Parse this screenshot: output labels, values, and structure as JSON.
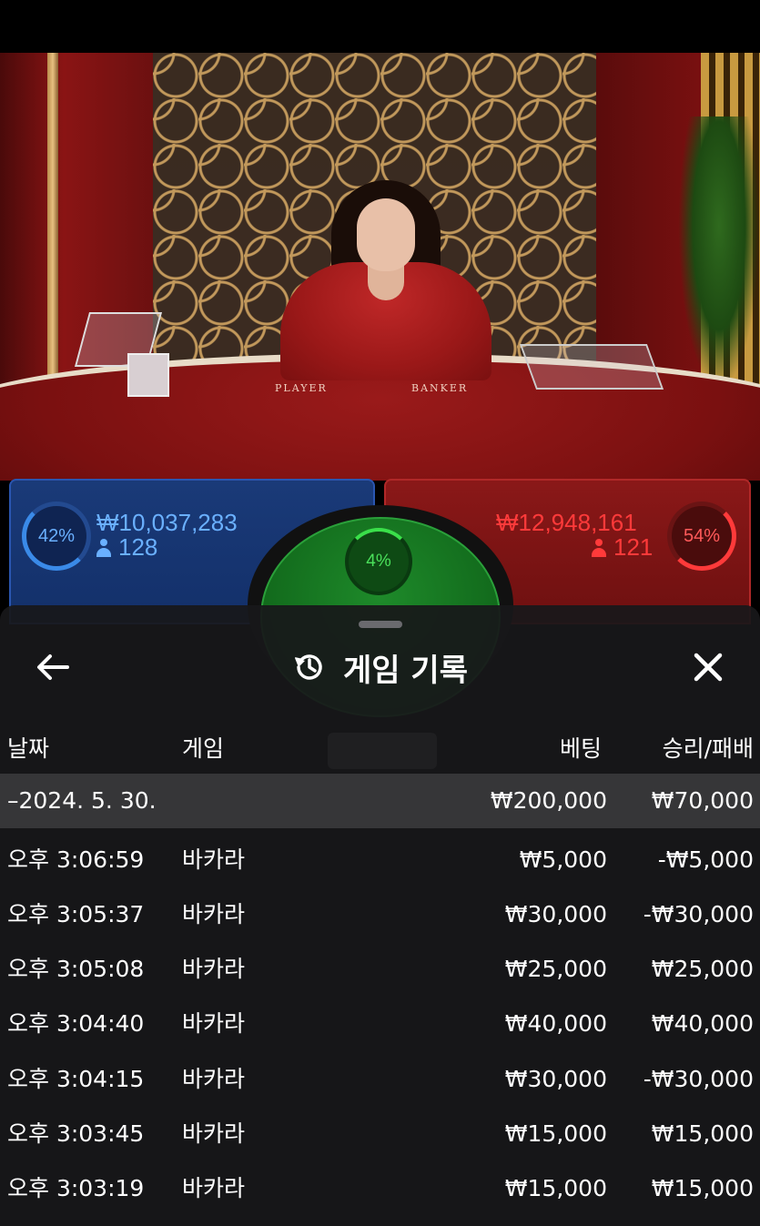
{
  "live": {
    "table_labels": {
      "player": "PLAYER",
      "banker": "BANKER"
    }
  },
  "bets": {
    "player": {
      "percent": "42%",
      "amount": "₩10,037,283",
      "players": "128",
      "color": "#3a8ae8"
    },
    "tie": {
      "percent": "4%",
      "color": "#2aa03a"
    },
    "banker": {
      "percent": "54%",
      "amount": "₩12,948,161",
      "players": "121",
      "color": "#ff3a3a"
    }
  },
  "history": {
    "title": "게임 기록",
    "icons": {
      "back": "arrow-left-icon",
      "title": "history-icon",
      "close": "close-icon"
    },
    "columns": {
      "date": "날짜",
      "game": "게임",
      "bet": "베팅",
      "result": "승리/패배"
    },
    "date_group": {
      "label": "–2024. 5. 30.",
      "bet_total": "₩200,000",
      "result_total": "₩70,000"
    },
    "rows": [
      {
        "time": "오후 3:06:59",
        "game": "바카라",
        "bet": "₩5,000",
        "result": "-₩5,000"
      },
      {
        "time": "오후 3:05:37",
        "game": "바카라",
        "bet": "₩30,000",
        "result": "-₩30,000"
      },
      {
        "time": "오후 3:05:08",
        "game": "바카라",
        "bet": "₩25,000",
        "result": "₩25,000"
      },
      {
        "time": "오후 3:04:40",
        "game": "바카라",
        "bet": "₩40,000",
        "result": "₩40,000"
      },
      {
        "time": "오후 3:04:15",
        "game": "바카라",
        "bet": "₩30,000",
        "result": "-₩30,000"
      },
      {
        "time": "오후 3:03:45",
        "game": "바카라",
        "bet": "₩15,000",
        "result": "₩15,000"
      },
      {
        "time": "오후 3:03:19",
        "game": "바카라",
        "bet": "₩15,000",
        "result": "₩15,000"
      }
    ]
  }
}
